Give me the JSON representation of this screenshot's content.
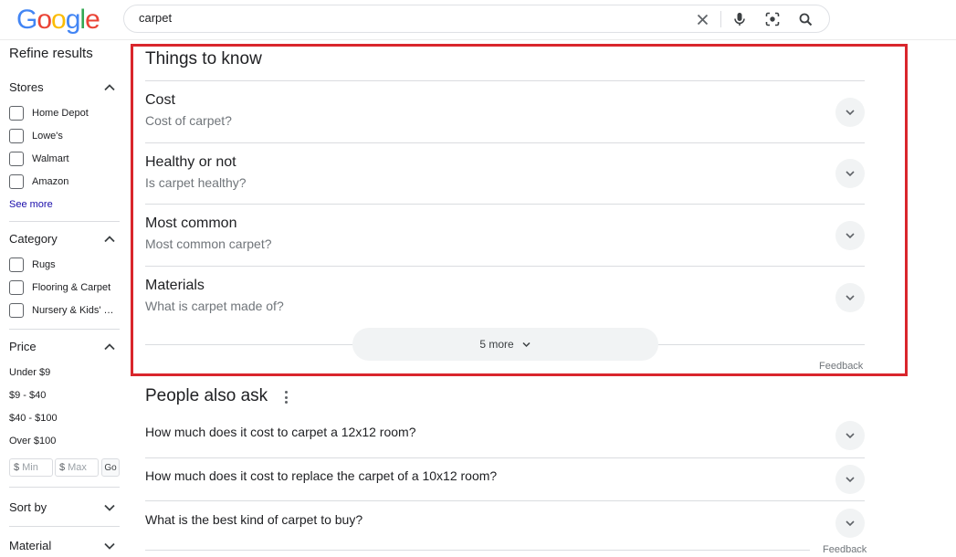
{
  "header": {
    "logo": "Google",
    "search_value": "carpet",
    "icons": [
      "clear-icon",
      "mic-icon",
      "lens-icon",
      "search-icon"
    ]
  },
  "sidebar": {
    "title": "Refine results",
    "stores": {
      "label": "Stores",
      "items": [
        "Home Depot",
        "Lowe's",
        "Walmart",
        "Amazon"
      ],
      "see_more": "See more"
    },
    "category": {
      "label": "Category",
      "items": [
        "Rugs",
        "Flooring & Carpet",
        "Nursery & Kids' R..."
      ]
    },
    "price": {
      "label": "Price",
      "items": [
        "Under $9",
        "$9 - $40",
        "$40 - $100",
        "Over $100"
      ],
      "min_currency": "$",
      "min_placeholder": "Min",
      "max_currency": "$",
      "max_placeholder": "Max",
      "go": "Go"
    },
    "sort_by": "Sort by",
    "material": "Material"
  },
  "things_to_know": {
    "title": "Things to know",
    "items": [
      {
        "title": "Cost",
        "subtitle": "Cost of carpet?"
      },
      {
        "title": "Healthy or not",
        "subtitle": "Is carpet healthy?"
      },
      {
        "title": "Most common",
        "subtitle": "Most common carpet?"
      },
      {
        "title": "Materials",
        "subtitle": "What is carpet made of?"
      }
    ],
    "more_label": "5 more",
    "feedback": "Feedback"
  },
  "people_also_ask": {
    "title": "People also ask",
    "questions": [
      "How much does it cost to carpet a 12x12 room?",
      "How much does it cost to replace the carpet of a 10x12 room?",
      "What is the best kind of carpet to buy?"
    ],
    "feedback": "Feedback"
  },
  "colors": {
    "highlight_border": "#d9262c",
    "link": "#1a0dab",
    "subtext": "#70757a"
  }
}
